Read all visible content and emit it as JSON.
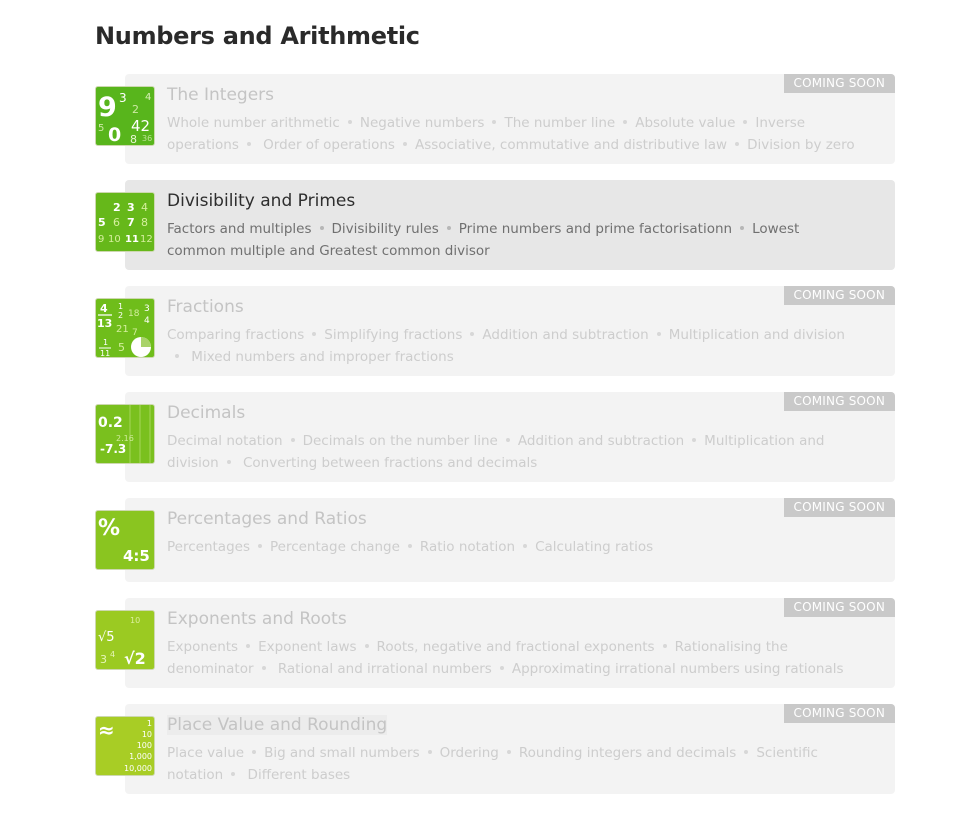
{
  "page": {
    "title": "Numbers and Arithmetic"
  },
  "courses": [
    {
      "title": "The Integers",
      "badge": "COMING SOON",
      "icon": "integers-icon",
      "topics": [
        "Whole number arithmetic",
        "Negative numbers",
        "The number line",
        "Absolute value",
        "Inverse operations",
        "Order of operations",
        "Associative, commutative and distributive law",
        "Division by zero"
      ]
    },
    {
      "title": "Divisibility and Primes",
      "badge": "",
      "icon": "divisibility-icon",
      "topics": [
        "Factors and multiples",
        "Divisibility rules",
        "Prime numbers and prime factorisationn",
        "Lowest common multiple and Greatest common divisor"
      ]
    },
    {
      "title": "Fractions",
      "badge": "COMING SOON",
      "icon": "fractions-icon",
      "topics": [
        "Comparing fractions",
        "Simplifying fractions",
        "Addition and subtraction",
        "Multiplication and division",
        "Mixed numbers and improper fractions"
      ]
    },
    {
      "title": "Decimals",
      "badge": "COMING SOON",
      "icon": "decimals-icon",
      "topics": [
        "Decimal notation",
        "Decimals on the number line",
        "Addition and subtraction",
        "Multiplication and division",
        "Converting between fractions and decimals"
      ]
    },
    {
      "title": "Percentages and Ratios",
      "badge": "COMING SOON",
      "icon": "percentages-icon",
      "topics": [
        "Percentages",
        "Percentage change",
        "Ratio notation",
        "Calculating ratios"
      ]
    },
    {
      "title": "Exponents and Roots",
      "badge": "COMING SOON",
      "icon": "exponents-icon",
      "topics": [
        "Exponents",
        "Exponent laws",
        "Roots, negative and fractional exponents",
        "Rationalising the denominator",
        "Rational and irrational numbers",
        "Approximating irrational numbers using rationals"
      ]
    },
    {
      "title": "Place Value and Rounding",
      "badge": "COMING SOON",
      "icon": "place-value-icon",
      "topics": [
        "Place value",
        "Big and small numbers",
        "Ordering",
        "Rounding integers and decimals",
        "Scientific notation",
        "Different bases"
      ]
    }
  ],
  "icon_text": {
    "integers": [
      "9",
      "3",
      "4",
      "2",
      "5",
      "42",
      "0",
      "8",
      "36"
    ],
    "divisibility": [
      "2",
      "3",
      "4",
      "5",
      "6",
      "7",
      "8",
      "9",
      "10",
      "11",
      "12"
    ],
    "fractions": [
      "4",
      "13",
      "1",
      "2",
      "18",
      "3",
      "4",
      "21",
      "7",
      "1",
      "11",
      "5"
    ],
    "decimals": [
      "0.2",
      "-7.3",
      "2.16"
    ],
    "percentages": [
      "%",
      "4:5"
    ],
    "exponents": [
      "√5",
      "√2",
      "3",
      "4",
      "10"
    ],
    "place_value": [
      "≈",
      "1",
      "10",
      "100",
      "1,000",
      "10,000"
    ]
  },
  "colors": {
    "icon_green_1": "#58b51c",
    "icon_green_2": "#66b81a",
    "icon_green_3": "#6fbd1b",
    "icon_green_4": "#7ac01e",
    "icon_green_5": "#8ac520",
    "icon_green_6": "#9bca22",
    "icon_green_7": "#a8cd25",
    "badge": "#c9c9c9",
    "card": "#f3f3f3",
    "card_active": "#e7e7e7"
  }
}
